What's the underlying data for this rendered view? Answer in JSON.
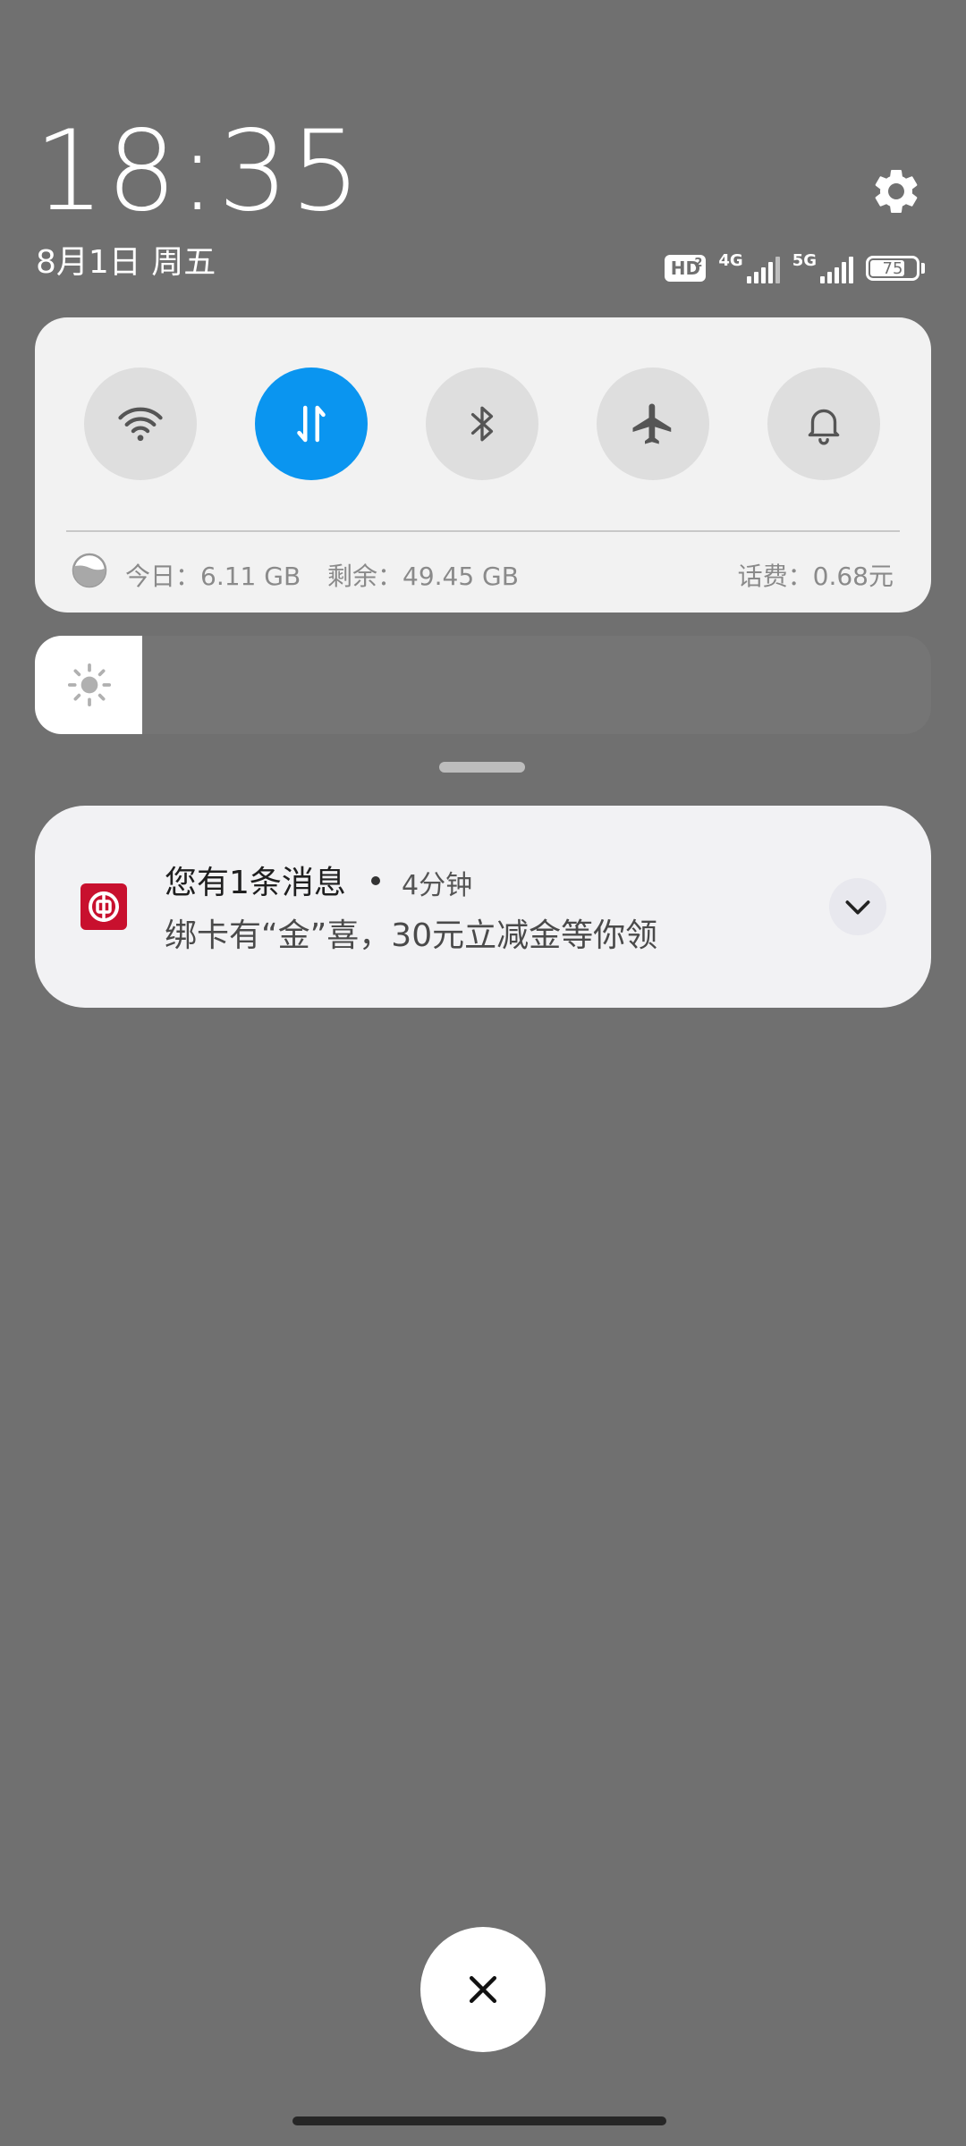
{
  "header": {
    "time": "18:35",
    "date": "8月1日 周五",
    "icons": {
      "settings": "gear-icon"
    }
  },
  "status": {
    "hd_label": "HD",
    "hd_sub": "2",
    "sim1_network": "4G",
    "sim2_network": "5G",
    "battery_level": "75",
    "battery_percent": 75
  },
  "quick_settings": {
    "toggles": [
      {
        "id": "wifi",
        "icon": "wifi-icon",
        "active": false
      },
      {
        "id": "mobile-data",
        "icon": "data-transfer-icon",
        "active": true
      },
      {
        "id": "bluetooth",
        "icon": "bluetooth-icon",
        "active": false
      },
      {
        "id": "airplane",
        "icon": "airplane-icon",
        "active": false
      },
      {
        "id": "ring",
        "icon": "bell-icon",
        "active": false
      }
    ],
    "usage": {
      "today": "今日：6.11 GB",
      "remaining": "剩余：49.45 GB",
      "fee": "话费：0.68元"
    }
  },
  "brightness": {
    "level_percent": 12,
    "icon": "sun-icon"
  },
  "notification": {
    "app_icon": "bank-of-china-icon",
    "title": "您有1条消息",
    "time": "4分钟",
    "body": "绑卡有“金”喜，30元立减金等你领",
    "expand_icon": "chevron-down-icon"
  },
  "bottom": {
    "close_icon": "close-icon"
  },
  "colors": {
    "background": "#707070",
    "card": "#f2f2f2",
    "accent": "#0a95f0",
    "bank_red": "#c8102e"
  }
}
